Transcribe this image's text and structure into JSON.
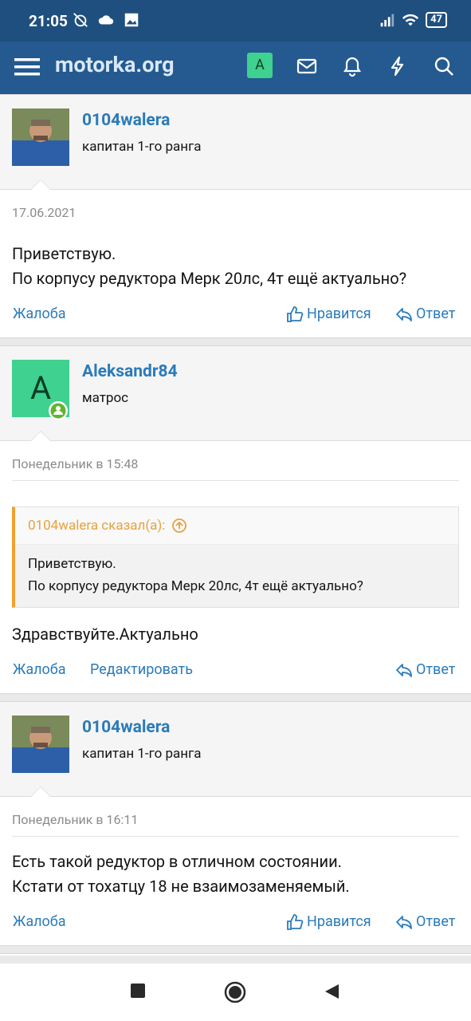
{
  "status": {
    "time": "21:05",
    "battery": "47"
  },
  "app": {
    "logo": "motorka.org",
    "avatar_letter": "A"
  },
  "posts": [
    {
      "user": "0104walera",
      "rank": "капитан 1-го ранга",
      "date": "17.06.2021",
      "text_lines": [
        "Приветствую.",
        "По корпусу редуктора Мерк 20лс, 4т ещё актуально?"
      ],
      "report": "Жалоба",
      "like": "Нравится",
      "reply": "Ответ"
    },
    {
      "user": "Aleksandr84",
      "rank": "матрос",
      "avatar_letter": "A",
      "date": "Понедельник в 15:48",
      "quote_author": "0104walera сказал(а):",
      "quote_lines": [
        "Приветствую.",
        "По корпусу редуктора Мерк 20лс, 4т ещё актуально?"
      ],
      "text": "Здравствуйте.Актуально",
      "report": "Жалоба",
      "edit": "Редактировать",
      "reply": "Ответ"
    },
    {
      "user": "0104walera",
      "rank": "капитан 1-го ранга",
      "date": "Понедельник в 16:11",
      "text_lines": [
        "Есть такой редуктор в отличном состоянии.",
        "Кстати от тохатцу 18 не взаимозаменяемый."
      ],
      "report": "Жалоба",
      "like": "Нравится",
      "reply": "Ответ"
    }
  ],
  "colors": {
    "appbar": "#245a8f",
    "link": "#2b7bb9",
    "quote_accent": "#f0a22e",
    "avatar_green": "#3fd18f"
  }
}
